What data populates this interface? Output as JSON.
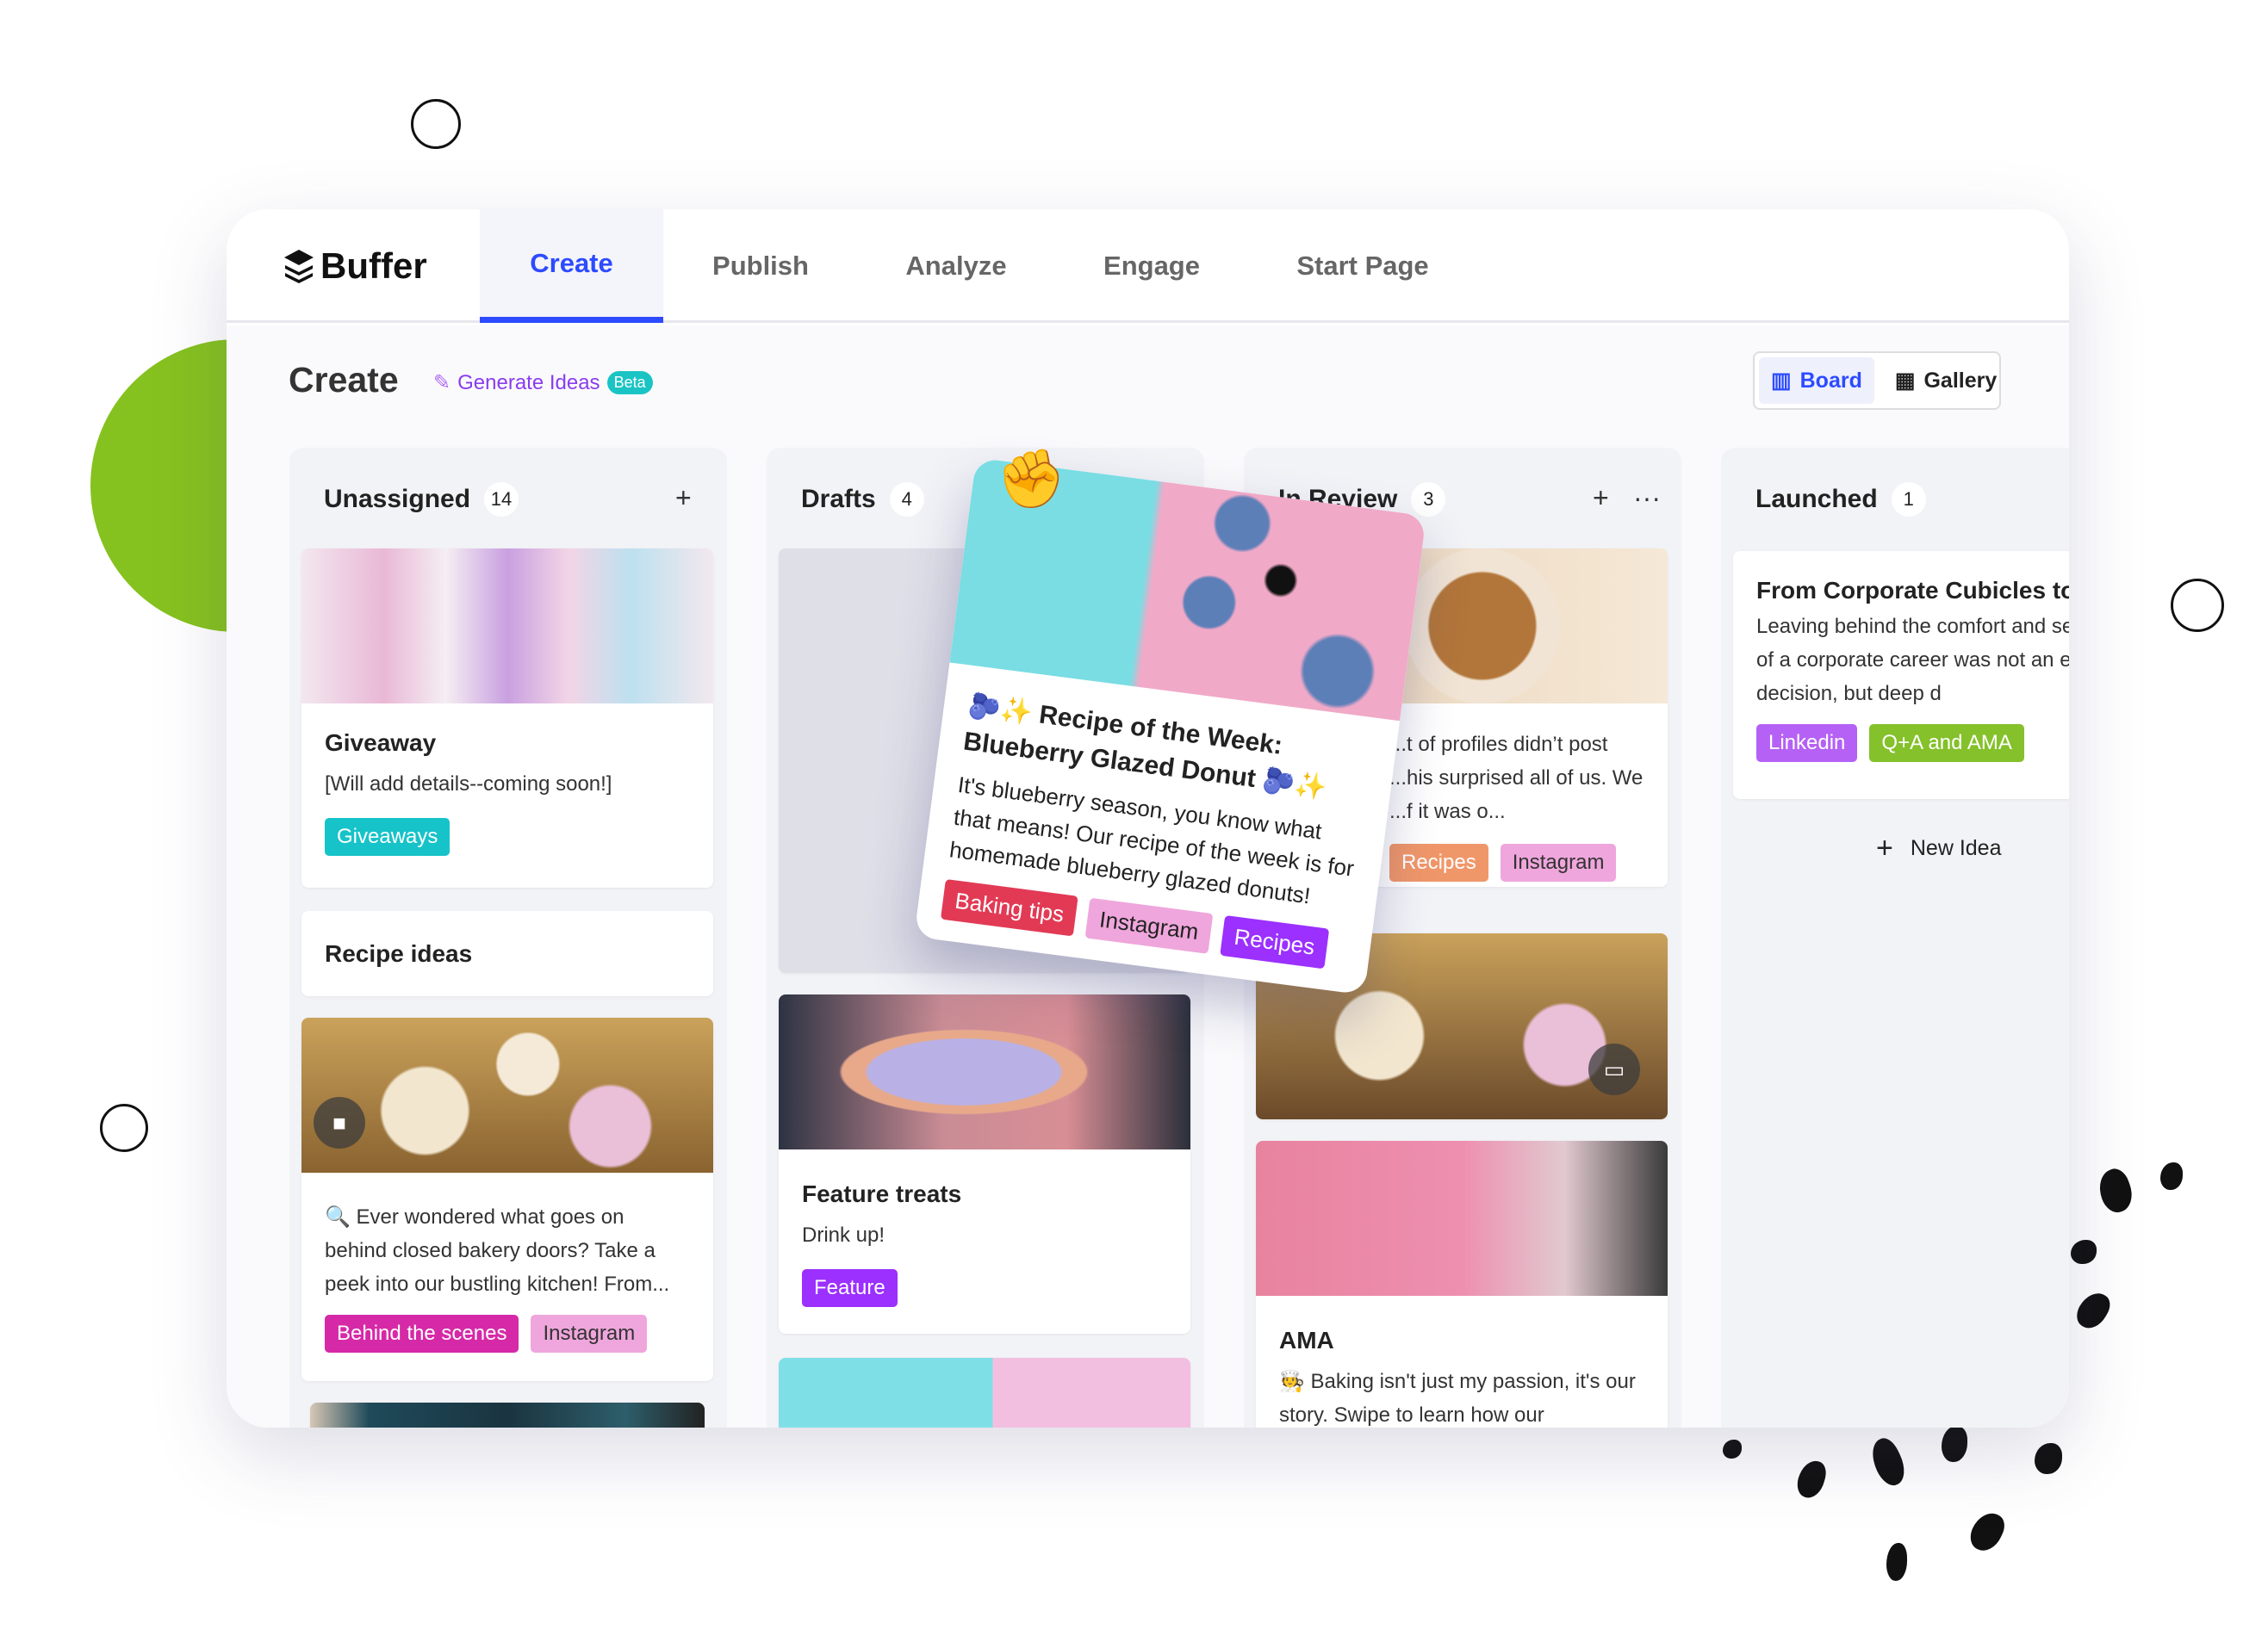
{
  "brand": {
    "name": "Buffer"
  },
  "nav": {
    "tabs": [
      {
        "label": "Create",
        "active": true
      },
      {
        "label": "Publish"
      },
      {
        "label": "Analyze"
      },
      {
        "label": "Engage"
      },
      {
        "label": "Start Page"
      }
    ]
  },
  "page": {
    "title": "Create",
    "generate_label": "Generate Ideas",
    "beta": "Beta"
  },
  "view_toggle": {
    "board": "Board",
    "gallery": "Gallery",
    "selected": "Board"
  },
  "columns": [
    {
      "title": "Unassigned",
      "count": "14",
      "add": "+",
      "cards": [
        {
          "title": "Giveaway",
          "text": "[Will add details--coming soon!]",
          "tags": [
            {
              "label": "Giveaways",
              "color": "#16c3c9"
            }
          ]
        },
        {
          "title": "Recipe ideas"
        },
        {
          "text": "🔍 Ever wondered what goes on behind closed bakery doors? Take a peek into our bustling kitchen! From...",
          "video": true,
          "tags": [
            {
              "label": "Behind the scenes",
              "color": "#d629a8"
            },
            {
              "label": "Instagram",
              "color": "#efa6dc"
            }
          ]
        }
      ]
    },
    {
      "title": "Drafts",
      "count": "4",
      "cards": [
        {
          "title": "Feature treats",
          "text": "Drink up!",
          "tags": [
            {
              "label": "Feature",
              "color": "#9b30ff"
            }
          ]
        }
      ]
    },
    {
      "title": "In Review",
      "count": "3",
      "add": "+",
      "more": "···",
      "cards": [
        {
          "text": "...t of profiles didn’t post ...his surprised all of us. We ...f it was o...",
          "tags": [
            {
              "label": "Recipes",
              "color": "#f0976a"
            },
            {
              "label": "Instagram",
              "color": "#efa6dc"
            }
          ]
        },
        {
          "video": true
        },
        {
          "title": "AMA",
          "text": "🧑‍🍳 Baking isn't just my passion, it's our story. Swipe to learn how our"
        }
      ]
    },
    {
      "title": "Launched",
      "count": "1",
      "cards": [
        {
          "title": "From Corporate Cubicles to",
          "text": "Leaving behind the comfort and security of a corporate career was not an easy decision, but deep d",
          "tags": [
            {
              "label": "Linkedin",
              "color": "#b561f5"
            },
            {
              "label": "Q+A and AMA",
              "color": "#84c12a"
            }
          ]
        }
      ],
      "new_idea": "New Idea"
    }
  ],
  "dragged_card": {
    "title": "🫐✨ Recipe of the Week: Blueberry Glazed Donut 🫐✨",
    "text": "It's blueberry season, you know what that means! Our recipe of the week is for homemade blueberry glazed donuts!",
    "tags": [
      {
        "label": "Baking tips",
        "color": "#e23a55"
      },
      {
        "label": "Instagram",
        "color": "#efa6dc"
      },
      {
        "label": "Recipes",
        "color": "#9b30ff"
      }
    ]
  },
  "colors": {
    "accent": "#2c4bff",
    "decor_green": "#86c21f"
  }
}
